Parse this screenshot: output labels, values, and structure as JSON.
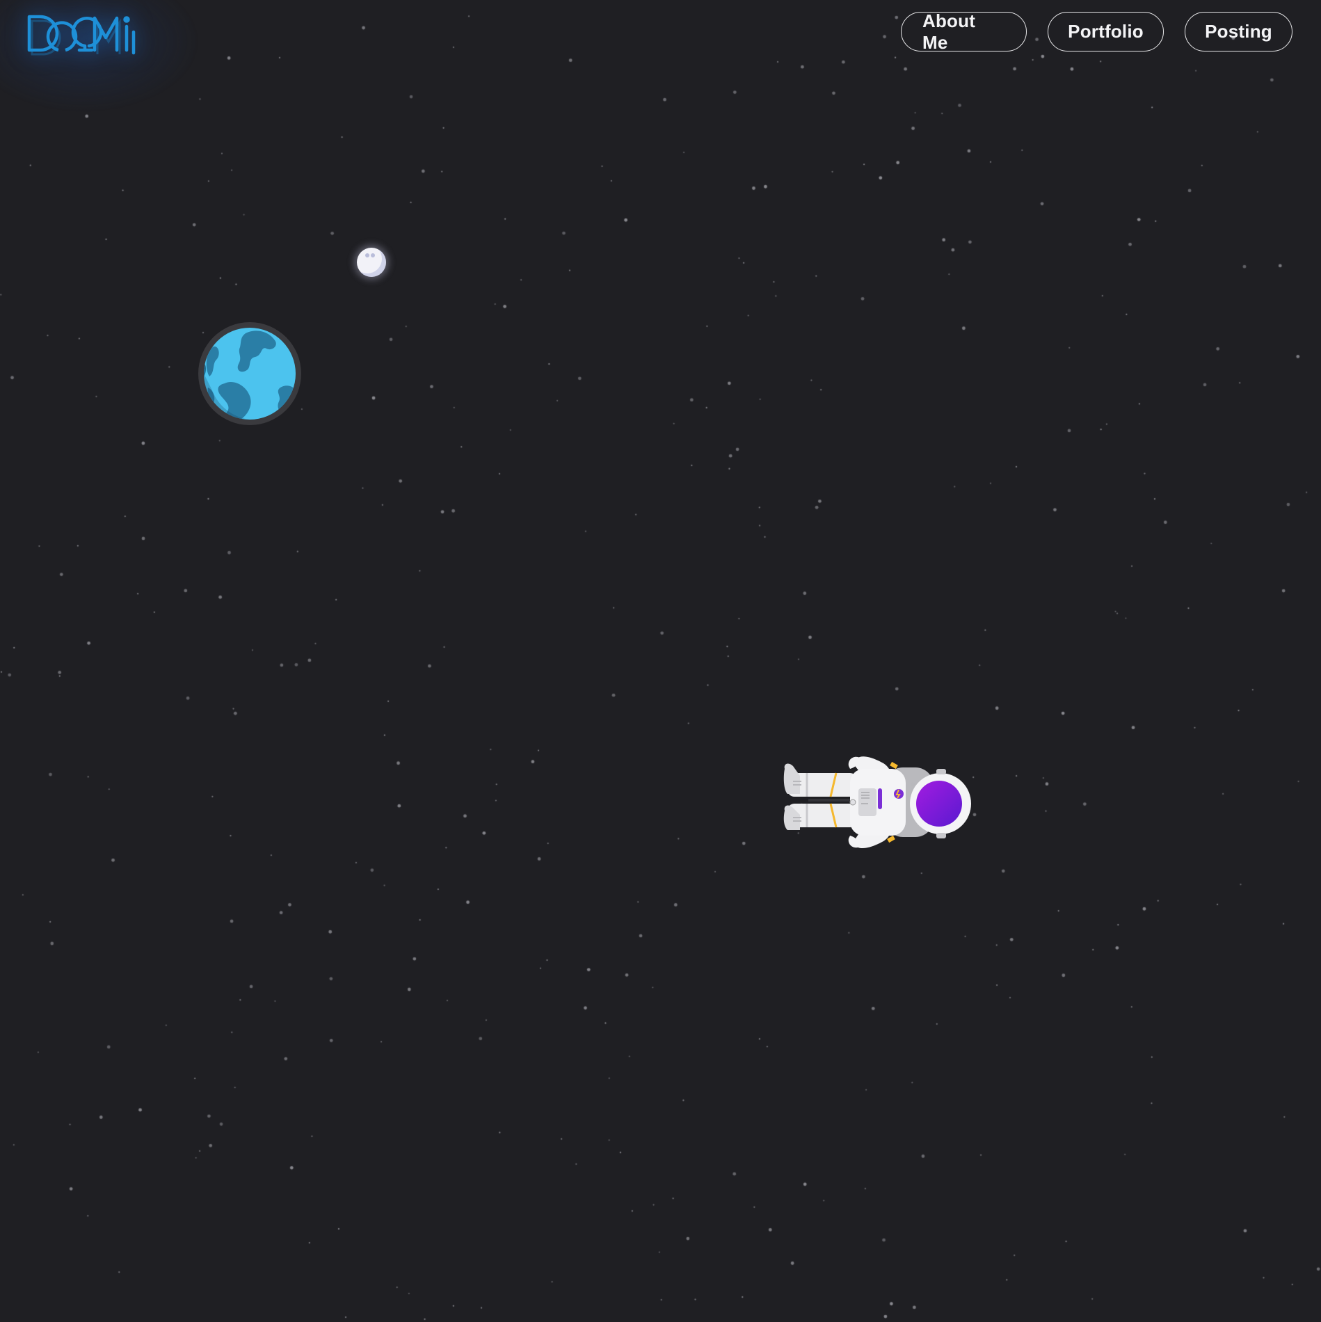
{
  "header": {
    "logo_text": "DOMi",
    "nav": [
      {
        "label": "About Me"
      },
      {
        "label": "Portfolio"
      },
      {
        "label": "Posting"
      }
    ]
  },
  "scene": {
    "icons": [
      "moon-icon",
      "earth-icon",
      "astronaut-icon"
    ],
    "colors": {
      "background": "#1f1f23",
      "star": "#8a8a90",
      "logo": "#1e90d8",
      "earth_ocean": "#4cc3ee",
      "earth_land": "#2a7ea6",
      "visor": "#8c1ad6"
    }
  }
}
